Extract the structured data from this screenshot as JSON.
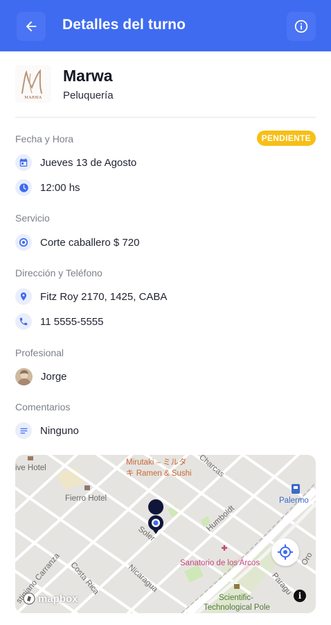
{
  "appbar": {
    "title": "Detalles del turno",
    "back_icon": "arrow-left-icon",
    "info_icon": "info-icon",
    "color": "#3f6bf1"
  },
  "business": {
    "name": "Marwa",
    "category": "Peluquería",
    "logo_text": "MARWA"
  },
  "status": {
    "label": "PENDIENTE",
    "color": "#f7bf16"
  },
  "sections": {
    "datetime": {
      "label": "Fecha y Hora",
      "date": "Jueves 13 de Agosto",
      "time": "12:00 hs"
    },
    "service": {
      "label": "Servicio",
      "value": "Corte caballero $ 720"
    },
    "contact": {
      "label": "Dirección y Teléfono",
      "address": "Fitz Roy 2170, 1425, CABA",
      "phone": "11 5555-5555"
    },
    "professional": {
      "label": "Profesional",
      "name": "Jorge"
    },
    "comments": {
      "label": "Comentarios",
      "value": "Ninguno"
    }
  },
  "map": {
    "labels": {
      "live_hotel": "ive Hotel",
      "mirutaki_1": "Mirutaki – ミルタ",
      "mirutaki_2": "キ Ramen & Sushi",
      "charcas": "Charcas",
      "fierro": "Fierro Hotel",
      "palermo": "Palermo",
      "soler": "Soler",
      "humboldt": "Humboldt",
      "sanatorio": "Sanatorio de los Arcos",
      "carranza": "stiniano Carranza",
      "costa_rica": "Costa Rica",
      "nicaragua": "Nicaragua",
      "oro": "Oro",
      "paraguay": "Paragu",
      "scientific_1": "Scientific-",
      "scientific_2": "Technological Pole",
      "mapbox": "mapbox",
      "attribution": "i"
    }
  }
}
